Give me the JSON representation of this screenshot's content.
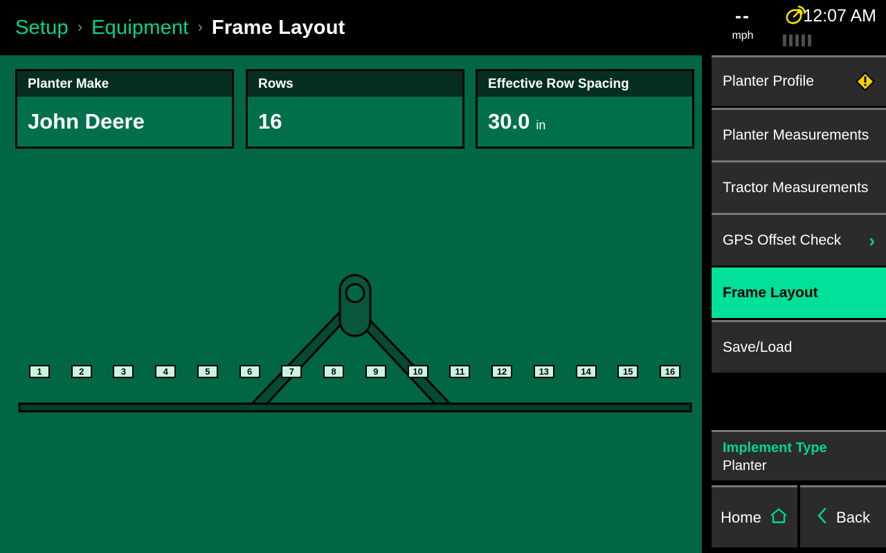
{
  "header": {
    "breadcrumb": [
      {
        "label": "Setup",
        "current": false
      },
      {
        "label": "Equipment",
        "current": false
      },
      {
        "label": "Frame Layout",
        "current": true
      }
    ],
    "separator": "›",
    "status": {
      "speed_value": "--",
      "speed_unit": "mph",
      "gps_icon": "satellite-dish-icon",
      "signal_bars": 5,
      "signal_bars_active": 0,
      "time": "12:07 AM"
    }
  },
  "cards": [
    {
      "title": "Planter Make",
      "value": "John Deere",
      "unit": ""
    },
    {
      "title": "Rows",
      "value": "16",
      "unit": ""
    },
    {
      "title": "Effective Row Spacing",
      "value": "30.0",
      "unit": "in"
    }
  ],
  "diagram": {
    "name": "planter-frame-layout",
    "implement_shape": "toolbar-with-a-frame-hitch",
    "row_count": 16,
    "row_labels": [
      "1",
      "2",
      "3",
      "4",
      "5",
      "6",
      "7",
      "8",
      "9",
      "10",
      "11",
      "12",
      "13",
      "14",
      "15",
      "16"
    ],
    "toolbar_color": "#054a34",
    "outline_color": "#000000",
    "row_tag_fill": "#c9f5e0"
  },
  "sidebar": {
    "items": [
      {
        "label": "Planter Profile",
        "active": false,
        "icon": "warning-diamond-icon",
        "chevron": false
      },
      {
        "label": "Planter Measurements",
        "active": false,
        "icon": "",
        "chevron": false
      },
      {
        "label": "Tractor Measurements",
        "active": false,
        "icon": "",
        "chevron": false
      },
      {
        "label": "GPS Offset Check",
        "active": false,
        "icon": "",
        "chevron": true
      },
      {
        "label": "Frame Layout",
        "active": true,
        "icon": "",
        "chevron": false
      },
      {
        "label": "Save/Load",
        "active": false,
        "icon": "",
        "chevron": false
      }
    ],
    "implement_type": {
      "label": "Implement Type",
      "value": "Planter"
    },
    "nav": {
      "home_label": "Home",
      "home_icon": "home-icon",
      "back_label": "Back",
      "back_icon": "chevron-left-icon"
    }
  },
  "colors": {
    "canvas_green": "#006644",
    "card_body_green": "#00704c",
    "card_header_green": "#062e20",
    "accent_teal": "#00e09b",
    "accent_link": "#00d68f",
    "warning_yellow": "#f2d100",
    "sidebar_item": "#2b2b2b",
    "divider_gray": "#787878"
  }
}
